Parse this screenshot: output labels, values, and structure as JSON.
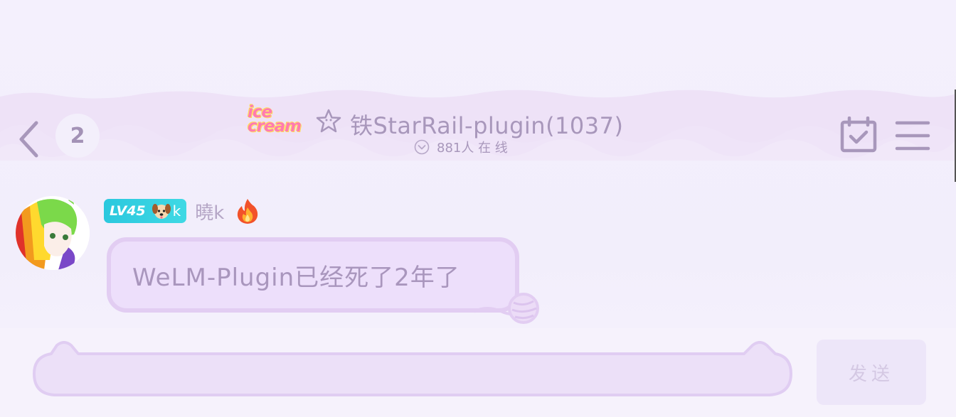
{
  "header": {
    "unread_count": "2",
    "logo_text": "ice cream",
    "group_name": "铁StarRail-plugin(1037)",
    "online_status": "881人 在 线"
  },
  "message": {
    "sender": {
      "level": "LV45",
      "badge_suffix": "k",
      "name": "曉k"
    },
    "text": "WeLM-Plugin已经死了2年了"
  },
  "composer": {
    "input_value": "",
    "send_label": "发送"
  },
  "colors": {
    "theme_text": "#a897bb",
    "bubble_bg": "#eddffb",
    "bubble_border": "#e2cdf2",
    "level_badge": "#2bc8de"
  },
  "icons": {
    "back": "chevron-left-icon",
    "star": "star-outline-icon",
    "online": "chevron-down-circle-icon",
    "calendar": "calendar-check-icon",
    "menu": "hamburger-menu-icon",
    "fire": "fire-icon",
    "yarn": "yarn-ball-icon"
  }
}
